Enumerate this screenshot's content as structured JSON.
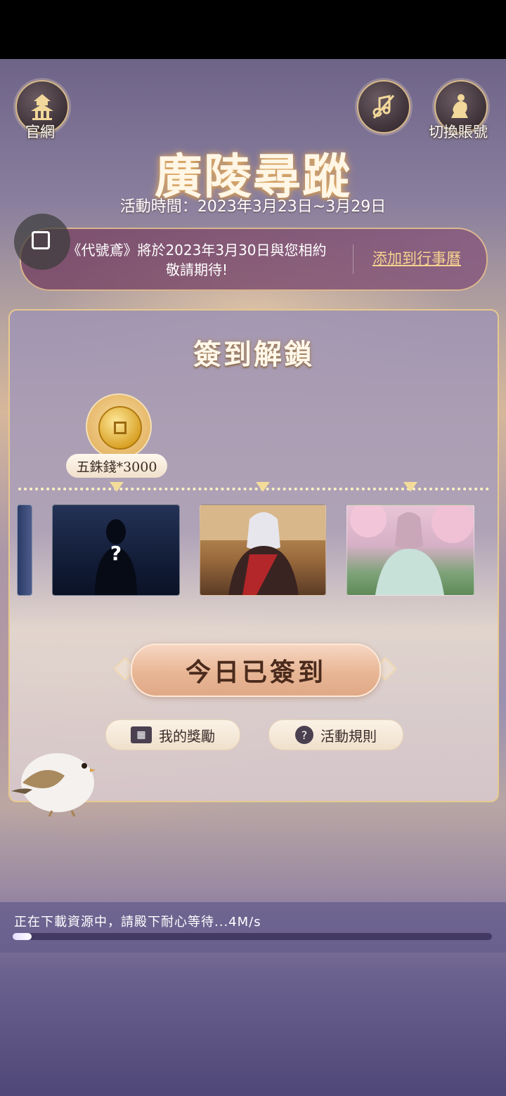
{
  "header": {
    "official_site_label": "官網",
    "switch_account_label": "切換賬號",
    "title": "廣陵尋蹤",
    "event_time": "活動時間：2023年3月23日~3月29日"
  },
  "notice": {
    "line1": "《代號鳶》將於2023年3月30日與您相約",
    "line2": "敬請期待!",
    "calendar_link": "添加到行事曆"
  },
  "panel": {
    "title": "簽到解鎖",
    "reward_label": "五銖錢*3000",
    "mystery_mark": "?",
    "signed_button": "今日已簽到",
    "my_rewards_label": "我的獎勵",
    "rules_label": "活動規則",
    "rules_icon_text": "?"
  },
  "download": {
    "text": "正在下載資源中，請殿下耐心等待...4M/s",
    "progress": 0.04
  },
  "colors": {
    "accent_gold": "#e8c98d",
    "link": "#f6d28f",
    "button": "#e8b695"
  }
}
